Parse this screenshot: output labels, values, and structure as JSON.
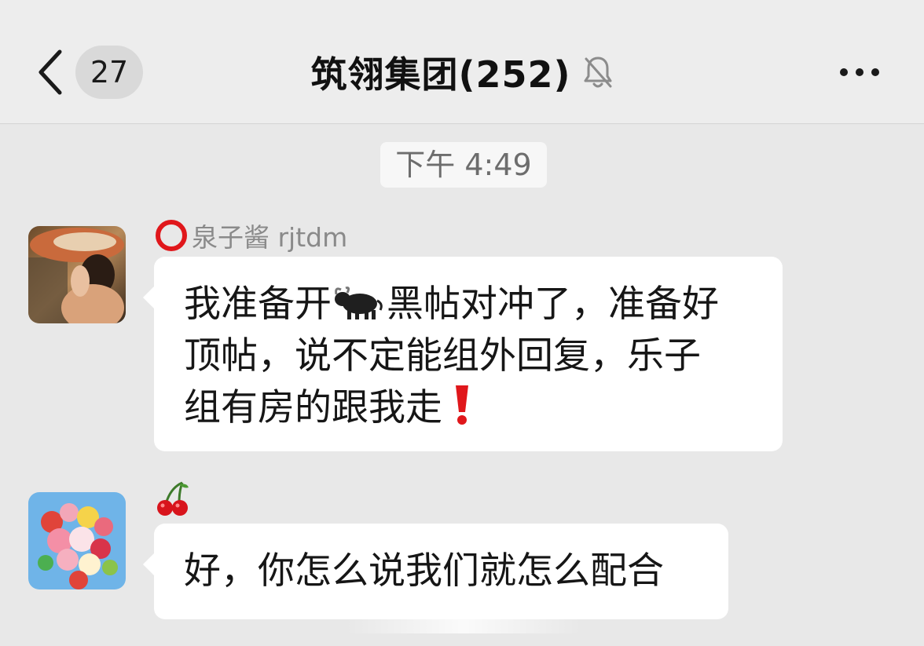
{
  "header": {
    "back_icon": "chevron-left-icon",
    "unread_count": "27",
    "title": "筑翎集团(252)",
    "mute_icon": "bell-muted-icon",
    "more_icon": "more-dots-icon"
  },
  "messages": {
    "timestamp": "下午 4:49",
    "items": [
      {
        "sender": "泉子酱 rjtdm",
        "sender_badge": "red-circle-icon",
        "text_lines": [
          "我准备开",
          "黑帖对冲了，准备好",
          "顶帖，说不定能组外回复，乐子",
          "组有房的跟我走"
        ],
        "emoji": [
          "ox-icon",
          "exclamation-icon"
        ]
      },
      {
        "sender_badge": "cherries-icon",
        "text": "好，你怎么说我们就怎么配合"
      }
    ]
  },
  "colors": {
    "header_bg": "#ededed",
    "chat_bg": "#e8e8e8",
    "bubble_bg": "#ffffff",
    "badge_red": "#e0171b"
  }
}
